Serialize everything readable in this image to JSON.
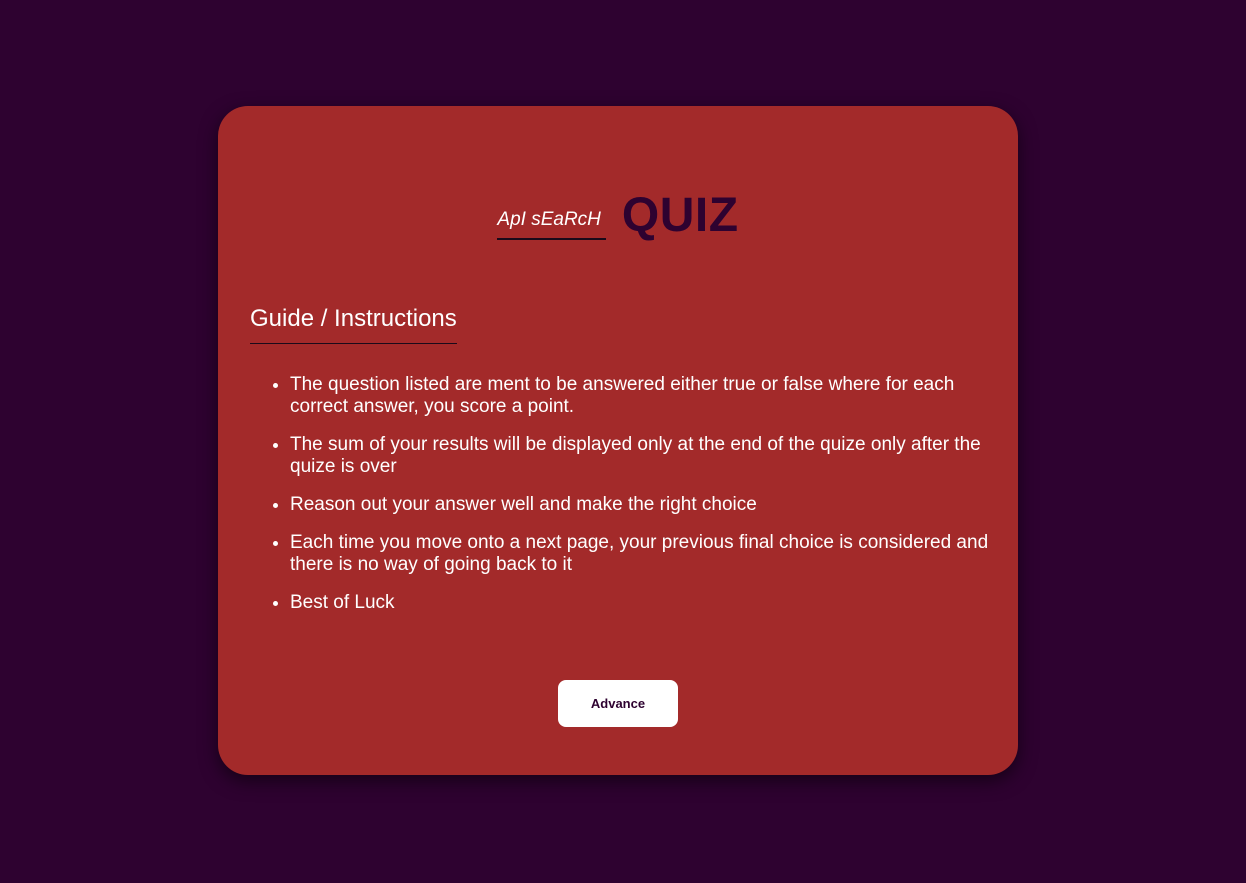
{
  "header": {
    "subtitle": "ApI sEaRcH",
    "title": "QUIZ"
  },
  "guide": {
    "heading": "Guide / Instructions",
    "items": [
      "The question listed are ment to be answered either true or false where for each correct answer, you score a point.",
      "The sum of your results will be displayed only at the end of the quize only after the quize is over",
      "Reason out your answer well and make the right choice",
      "Each time you move onto a next page, your previous final choice is considered and there is no way of going back to it",
      "Best of Luck"
    ]
  },
  "actions": {
    "advance_label": "Advance"
  },
  "colors": {
    "background": "#2e0230",
    "card": "#a32a2a",
    "title": "#2e0230",
    "button": "#ffffff"
  }
}
